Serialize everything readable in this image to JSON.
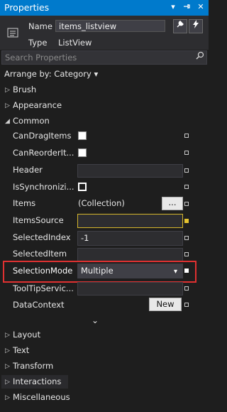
{
  "window": {
    "title": "Properties"
  },
  "header": {
    "name_label": "Name",
    "name_value": "items_listview",
    "type_label": "Type",
    "type_value": "ListView"
  },
  "search": {
    "placeholder": "Search Properties"
  },
  "arrange": {
    "label": "Arrange by: Category ▾"
  },
  "categories": {
    "brush": "Brush",
    "appearance": "Appearance",
    "common": "Common",
    "layout": "Layout",
    "text": "Text",
    "transform": "Transform",
    "interactions": "Interactions",
    "misc": "Miscellaneous"
  },
  "props": {
    "candrag": "CanDragItems",
    "canreorder": "CanReorderIt...",
    "header": "Header",
    "issync": "IsSynchronizi...",
    "items": "Items",
    "items_value": "(Collection)",
    "items_btn": "...",
    "itemssource": "ItemsSource",
    "selectedindex": "SelectedIndex",
    "selectedindex_value": "-1",
    "selecteditem": "SelectedItem",
    "selectionmode": "SelectionMode",
    "selectionmode_value": "Multiple",
    "tooltip": "ToolTipServic...",
    "datacontext": "DataContext",
    "new_btn": "New"
  },
  "colors": {
    "title_bar": "#007acc",
    "highlight": "#e03131",
    "itemssource_border": "#d4b52c"
  }
}
